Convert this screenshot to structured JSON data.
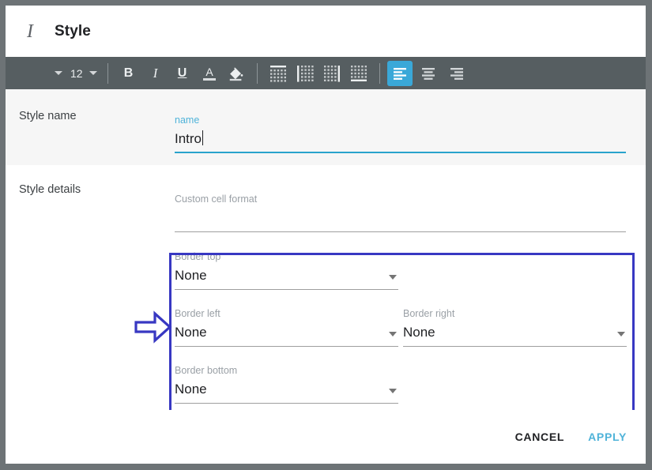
{
  "window": {
    "chrome_color": "#6d7376"
  },
  "dialog": {
    "title": "Style",
    "title_icon": "text-format-italic-icon"
  },
  "toolbar": {
    "background": "#565e61",
    "accent": "#3aa8d8",
    "font_name": {
      "icon": "chevron-down-icon",
      "value": ""
    },
    "font_size": {
      "value": "12",
      "icon": "chevron-down-icon"
    },
    "format_buttons": [
      {
        "name": "bold-button",
        "glyph": "B",
        "style": "bold",
        "active": false
      },
      {
        "name": "italic-button",
        "glyph": "I",
        "style": "italic",
        "active": false
      },
      {
        "name": "underline-button",
        "glyph": "U",
        "style": "under",
        "active": false
      },
      {
        "name": "text-color-button",
        "glyph": "A",
        "style": "color",
        "active": false
      },
      {
        "name": "fill-color-button",
        "glyph": "",
        "style": "bucket",
        "active": false
      }
    ],
    "border_buttons": [
      {
        "name": "border-top-button",
        "edge": "top",
        "active": false
      },
      {
        "name": "border-left-button",
        "edge": "left",
        "active": false
      },
      {
        "name": "border-right-button",
        "edge": "right",
        "active": false
      },
      {
        "name": "border-bottom-button",
        "edge": "bottom",
        "active": false
      }
    ],
    "align_buttons": [
      {
        "name": "align-left-button",
        "align": "left",
        "active": true
      },
      {
        "name": "align-center-button",
        "align": "center",
        "active": false
      },
      {
        "name": "align-right-button",
        "align": "right",
        "active": false
      }
    ]
  },
  "sections": {
    "style_name": {
      "label": "Style name",
      "background": "#f6f6f6",
      "field": {
        "label": "name",
        "value": "Intro",
        "focused": true,
        "accent": "#29a3cc",
        "has_cursor": true
      }
    },
    "style_details": {
      "label": "Style details",
      "background": "#ffffff",
      "custom_cell_format": {
        "label": "Custom cell format",
        "value": "",
        "placeholder": ""
      },
      "border_fields": [
        {
          "label": "Border top",
          "value": "None",
          "name": "border-top-select"
        },
        {
          "label": "Border left",
          "value": "None",
          "name": "border-left-select"
        },
        {
          "label": "Border right",
          "value": "None",
          "name": "border-right-select"
        },
        {
          "label": "Border bottom",
          "value": "None",
          "name": "border-bottom-select"
        }
      ]
    }
  },
  "annotation": {
    "highlight_color": "#3838c2",
    "arrow_color": "#3838c2",
    "arrow_direction": "right"
  },
  "footer": {
    "cancel_label": "CANCEL",
    "apply_label": "APPLY",
    "apply_color": "#4fb3d9"
  }
}
